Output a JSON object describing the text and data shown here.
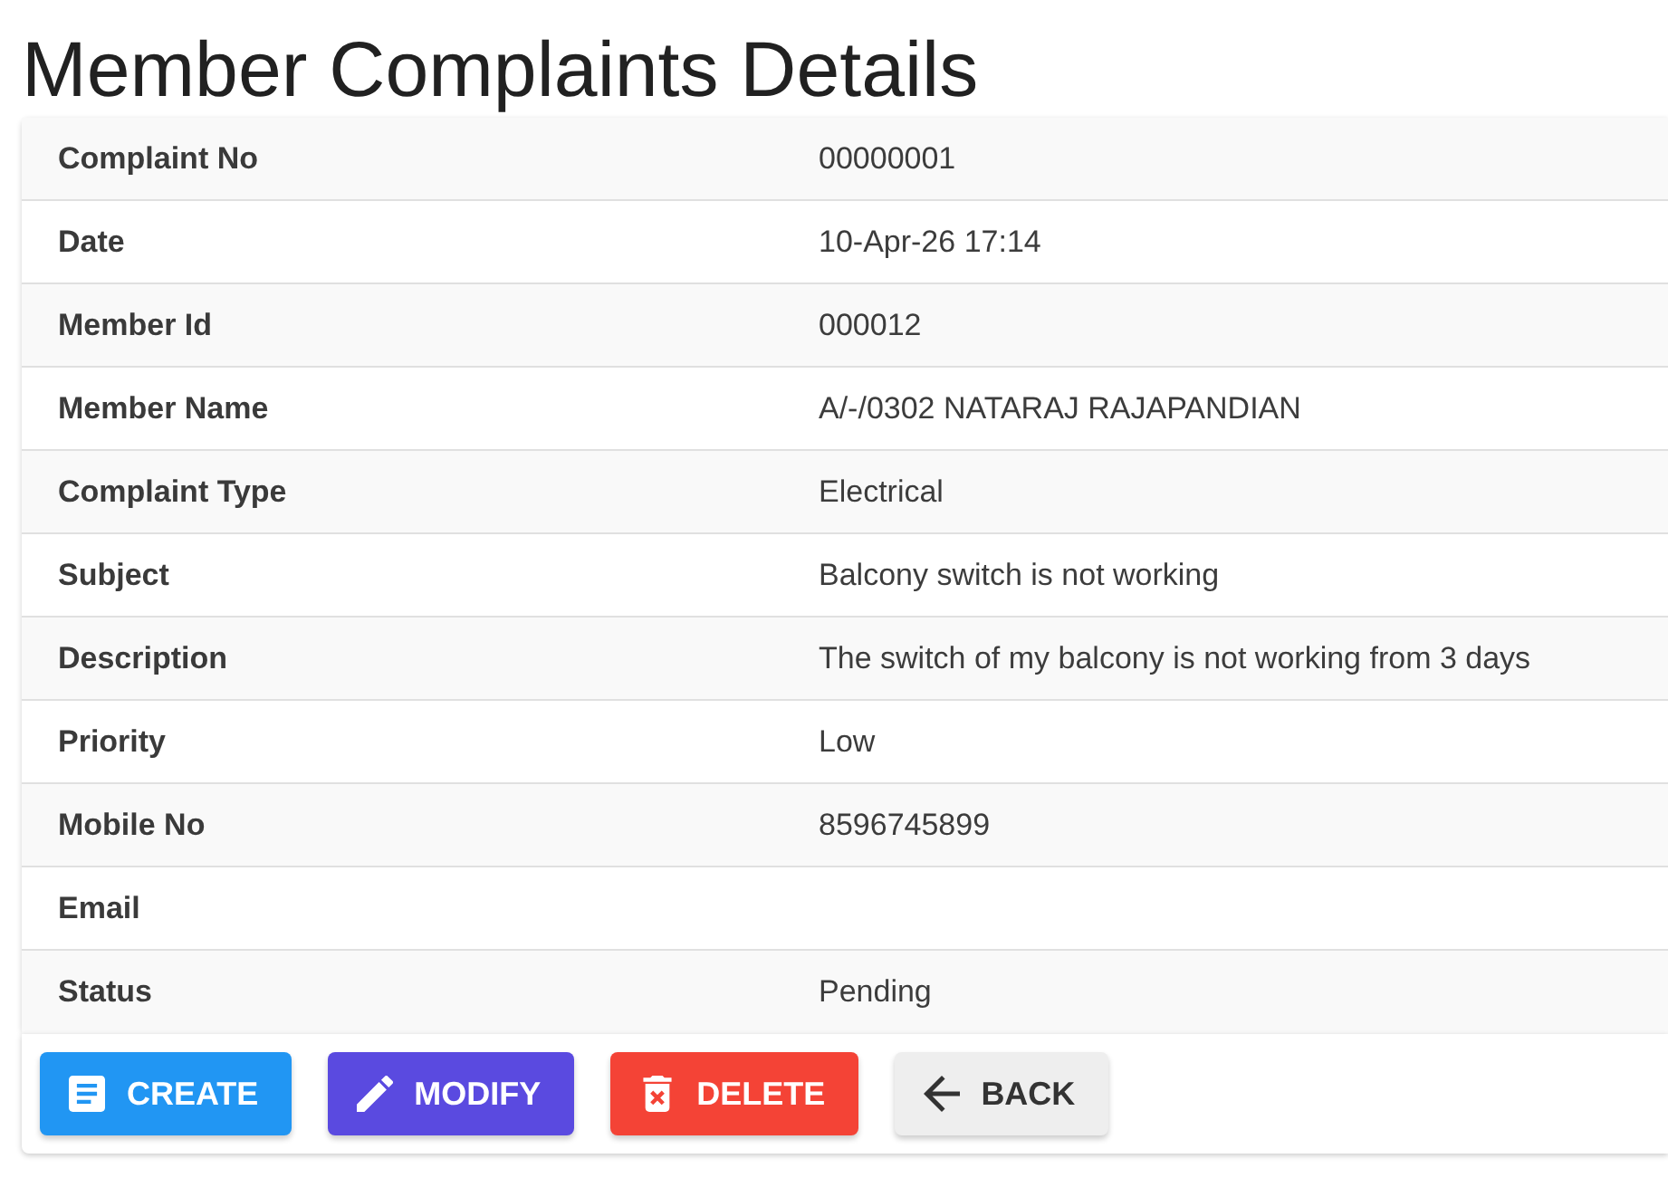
{
  "page": {
    "title": "Member Complaints Details"
  },
  "details": [
    {
      "label": "Complaint No",
      "value": "00000001"
    },
    {
      "label": "Date",
      "value": "10-Apr-26 17:14"
    },
    {
      "label": "Member Id",
      "value": "000012"
    },
    {
      "label": "Member Name",
      "value": "A/-/0302 NATARAJ RAJAPANDIAN"
    },
    {
      "label": "Complaint Type",
      "value": "Electrical"
    },
    {
      "label": "Subject",
      "value": "Balcony switch is not working"
    },
    {
      "label": "Description",
      "value": "The switch of my balcony is not working from 3 days"
    },
    {
      "label": "Priority",
      "value": "Low"
    },
    {
      "label": "Mobile No",
      "value": "8596745899"
    },
    {
      "label": "Email"
    },
    {
      "label": "Status",
      "value": "Pending"
    }
  ],
  "actions": [
    {
      "label": "CREATE",
      "kind": "create"
    },
    {
      "label": "MODIFY",
      "kind": "modify"
    },
    {
      "label": "DELETE",
      "kind": "delete"
    },
    {
      "label": "BACK",
      "kind": "back"
    }
  ]
}
